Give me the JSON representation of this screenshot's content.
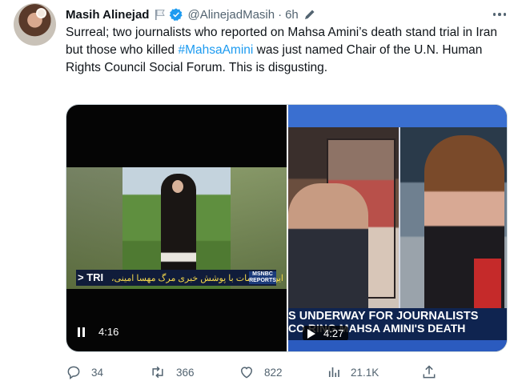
{
  "author": {
    "name": "Masih Alinejad",
    "handle": "@AlinejadMasih",
    "separator": "·",
    "time": "6h"
  },
  "tweet": {
    "text_before": "Surreal; two journalists who reported on Mahsa Amini’s death stand trial in Iran but those who killed ",
    "hashtag": "#MahsaAmini",
    "text_after": " was just named Chair of the U.N. Human Rights Council Social Forum. This is disgusting."
  },
  "media": {
    "left_video": {
      "caption_tag": "> TRI",
      "caption_farsi": "این محاکمات با پوشش خبری مرگ مهسا امینی،",
      "logo": "MSNBC REPORTS",
      "duration": "4:16"
    },
    "right_video": {
      "headline_line1": "S UNDERWAY FOR JOURNALISTS",
      "headline_line2": "CO  RING MAHSA AMINI'S DEATH",
      "duration": "4:27"
    }
  },
  "actions": {
    "replies": "34",
    "retweets": "366",
    "likes": "822",
    "views": "21.1K"
  },
  "colors": {
    "accent": "#1d9bf0",
    "secondary_text": "#536471",
    "primary_text": "#0f1419"
  }
}
